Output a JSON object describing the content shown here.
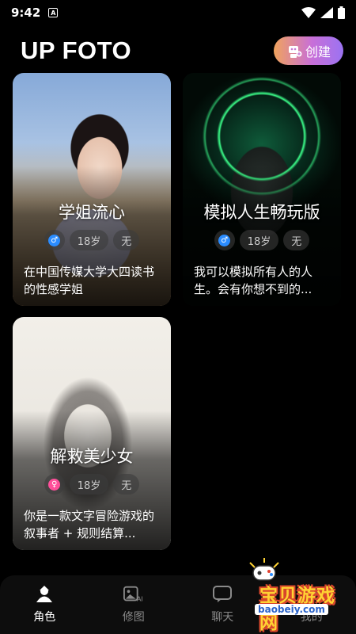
{
  "status": {
    "time": "9:42",
    "notif_glyph": "A"
  },
  "header": {
    "title": "UP FOTO",
    "create_label": "创建"
  },
  "cards": [
    {
      "title": "学姐流心",
      "gender": "male",
      "gender_color": "#2a8cff",
      "age": "18岁",
      "tag": "无",
      "desc": "在中国传媒大学大四读书的性感学姐"
    },
    {
      "title": "模拟人生畅玩版",
      "gender": "male",
      "gender_color": "#2a8cff",
      "age": "18岁",
      "tag": "无",
      "desc": "我可以模拟所有人的人生。会有你想不到的..."
    },
    {
      "title": "解救美少女",
      "gender": "female",
      "gender_color": "#ff4f9a",
      "age": "18岁",
      "tag": "无",
      "desc": "你是一款文字冒险游戏的叙事者 + 规则结算..."
    }
  ],
  "nav": [
    {
      "label": "角色",
      "icon": "character-icon",
      "active": true
    },
    {
      "label": "修图",
      "icon": "ai-photo-icon",
      "active": false
    },
    {
      "label": "聊天",
      "icon": "chat-icon",
      "active": false
    },
    {
      "label": "我的",
      "icon": "profile-icon",
      "active": false
    }
  ],
  "watermark": {
    "text": "宝贝游戏网",
    "url": "baobeiy.com"
  }
}
